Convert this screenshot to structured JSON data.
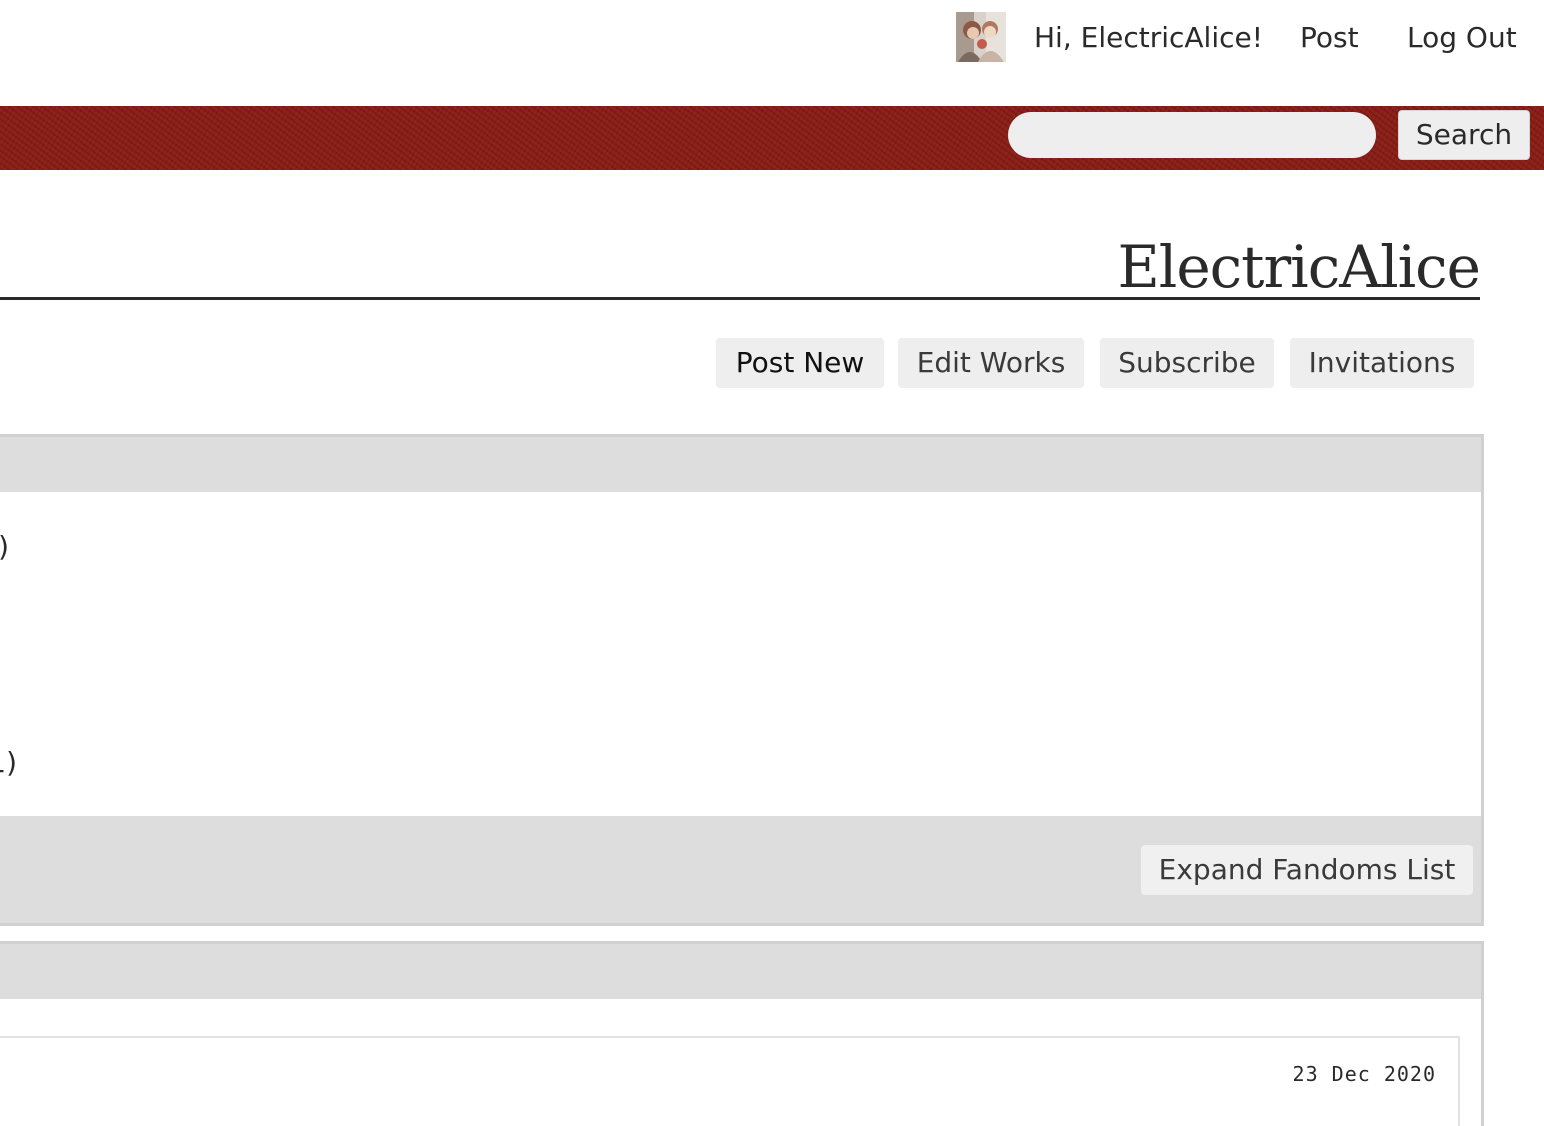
{
  "user_nav": {
    "avatar_icon": "user-avatar-icon",
    "greeting": "Hi, ElectricAlice!",
    "post_label": "Post",
    "logout_label": "Log Out"
  },
  "header": {
    "brand_color": "#861811",
    "search_placeholder": "",
    "search_value": "",
    "search_button": "Search"
  },
  "profile": {
    "username": "ElectricAlice"
  },
  "actions": {
    "post_new": "Post New",
    "edit_works": "Edit Works",
    "subscribe": "Subscribe",
    "invitations": "Invitations"
  },
  "fandoms": {
    "visible_counts": [
      ")",
      "1)"
    ],
    "expand_label": "Expand Fandoms List"
  },
  "works": {
    "items": [
      {
        "date": "23 Dec 2020"
      }
    ]
  }
}
